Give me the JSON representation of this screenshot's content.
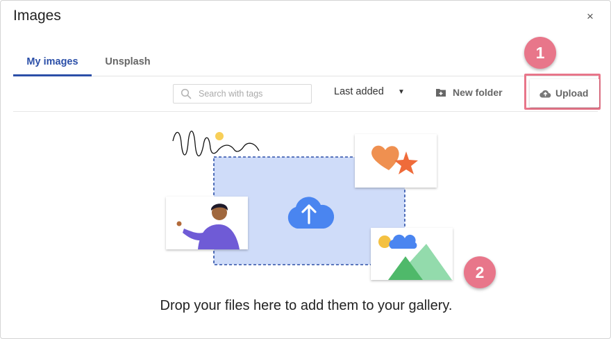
{
  "dialog": {
    "title": "Images",
    "close_glyph": "×"
  },
  "tabs": [
    {
      "label": "My images",
      "active": true
    },
    {
      "label": "Unsplash",
      "active": false
    }
  ],
  "toolbar": {
    "search_placeholder": "Search with tags",
    "search_icon": "search-icon",
    "sort_label": "Last added",
    "sort_caret_icon": "caret-down-icon",
    "new_folder_label": "New folder",
    "new_folder_icon": "folder-plus-icon",
    "upload_label": "Upload",
    "upload_icon": "cloud-upload-icon"
  },
  "annotations": {
    "badge_1": "1",
    "badge_2": "2",
    "color": "#e8768a"
  },
  "drop_zone": {
    "message": "Drop your files here to add them to your gallery.",
    "icon": "cloud-upload-icon"
  },
  "colors": {
    "accent": "#2b4fa8",
    "dropzone_fill": "#cfdcf9",
    "dropzone_border": "#2b4fa8",
    "cloud": "#4a85f0"
  }
}
